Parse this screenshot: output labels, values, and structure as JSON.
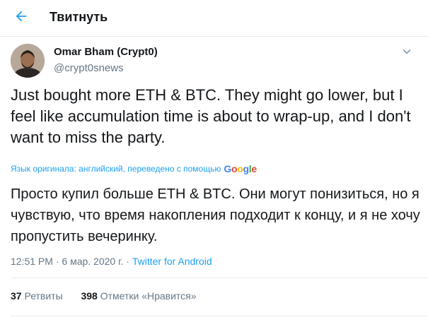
{
  "header": {
    "back_icon": "arrow-left-icon",
    "title": "Твитнуть"
  },
  "tweet": {
    "author_name": "Omar Bham (Crypt0)",
    "author_handle": "@crypt0snews",
    "text": "Just bought more ETH & BTC. They might go lower, but I feel like accumulation time is about to wrap-up, and I don't want to miss the party.",
    "translation_note": "Язык оригинала: английский, переведено с помощью",
    "translation_provider": "Google",
    "translated_text": "Просто купил больше ETH & BTC. Они могут понизиться, но я чувствую, что время накопления подходит к концу, и я не хочу пропустить вечеринку.",
    "time": "12:51 PM",
    "date": "6 мар. 2020 г.",
    "meta_separator": "·",
    "source": "Twitter for Android",
    "retweets_count": "37",
    "retweets_label": "Ретвиты",
    "likes_count": "398",
    "likes_label": "Отметки «Нравится»"
  },
  "colors": {
    "accent": "#1da1f2",
    "text": "#14171a",
    "muted": "#657786",
    "border": "#e6ecf0"
  }
}
